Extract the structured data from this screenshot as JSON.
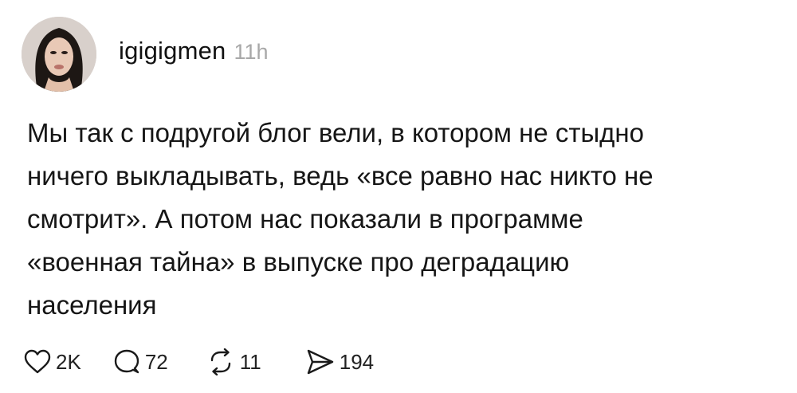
{
  "post": {
    "author": {
      "username": "igigigmen",
      "time_ago": "11h",
      "avatar_icon": "profile-photo"
    },
    "text": "Мы так с подругой блог вели, в котором не стыдно\nничего выкладывать, ведь «все равно нас никто не\nсмотрит». А потом нас показали в программе\n«военная тайна» в выпуске про деградацию\nнаселения",
    "actions": {
      "likes": "2K",
      "replies": "72",
      "reposts": "11",
      "shares": "194"
    }
  },
  "colors": {
    "text": "#161616",
    "timestamp": "#a8a8a8",
    "icon": "#1a1a1a"
  },
  "icons": {
    "like": "heart-icon",
    "reply": "comment-bubble-icon",
    "repost": "repost-arrows-icon",
    "share": "send-icon"
  }
}
